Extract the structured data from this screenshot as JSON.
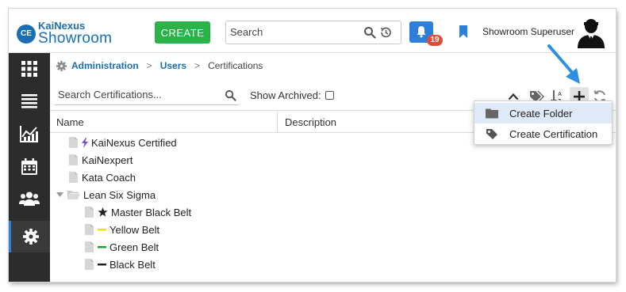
{
  "header": {
    "logo_badge": "CE",
    "logo_top": "KaiNexus",
    "logo_bottom": "Showroom",
    "create_label": "CREATE",
    "search_placeholder": "Search",
    "notification_count": "19",
    "user_name": "Showroom Superuser"
  },
  "sidebar": {
    "items": [
      {
        "icon": "grid-icon"
      },
      {
        "icon": "list-icon"
      },
      {
        "icon": "chart-icon"
      },
      {
        "icon": "calendar-icon"
      },
      {
        "icon": "people-icon"
      },
      {
        "icon": "gear-icon",
        "active": true
      }
    ]
  },
  "breadcrumb": {
    "items": [
      "Administration",
      "Users",
      "Certifications"
    ],
    "separator": ">"
  },
  "toolbar": {
    "search_placeholder": "Search Certifications...",
    "show_archived_label": "Show Archived:",
    "show_archived_checked": false
  },
  "table": {
    "columns": [
      "Name",
      "Description"
    ]
  },
  "tree": [
    {
      "label": "KaiNexus Certified",
      "marker": "bolt",
      "marker_color": "#7b4fd0",
      "depth": 1
    },
    {
      "label": "KaiNexpert",
      "marker": "none",
      "depth": 1
    },
    {
      "label": "Kata Coach",
      "marker": "none",
      "depth": 1
    },
    {
      "label": "Lean Six Sigma",
      "marker": "folder",
      "depth": 0,
      "expanded": true
    },
    {
      "label": "Master Black Belt",
      "marker": "star",
      "marker_color": "#222222",
      "depth": 2
    },
    {
      "label": "Yellow Belt",
      "marker": "belt",
      "marker_color": "#f2e11a",
      "depth": 2
    },
    {
      "label": "Green Belt",
      "marker": "belt",
      "marker_color": "#1c9e3a",
      "depth": 2
    },
    {
      "label": "Black Belt",
      "marker": "belt",
      "marker_color": "#222222",
      "depth": 2
    }
  ],
  "dropdown": {
    "items": [
      {
        "label": "Create Folder",
        "icon": "folder-icon",
        "highlighted": true
      },
      {
        "label": "Create Certification",
        "icon": "tag-icon",
        "highlighted": false
      }
    ]
  },
  "colors": {
    "brand_blue": "#1a6fb4",
    "create_green": "#2bb34a",
    "sidebar_bg": "#2c2c2c",
    "badge_red": "#e24b3b",
    "annotation_arrow": "#2e8fe0"
  }
}
